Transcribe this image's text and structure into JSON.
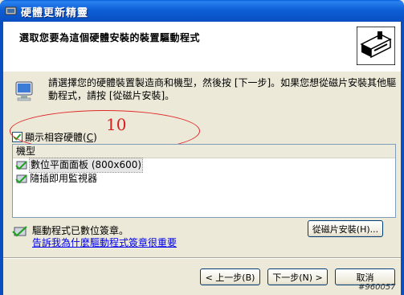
{
  "window": {
    "title": "硬體更新精靈"
  },
  "header": {
    "title": "選取您要為這個硬體安裝的裝置驅動程式"
  },
  "info": {
    "text": "請選擇您的硬體裝置製造商和機型，然後按 [下一步]。如果您想從磁片安裝其他驅動程式，請按 [從磁片安裝]。"
  },
  "compatible": {
    "label_prefix": "顯示相容硬體(",
    "label_key": "C",
    "label_suffix": ")",
    "checked": true
  },
  "annotation": {
    "number": "10"
  },
  "model_list": {
    "header": "機型",
    "items": [
      {
        "label": "數位平面面板 (800x600)",
        "selected": true
      },
      {
        "label": "隨插即用監視器",
        "selected": false
      }
    ]
  },
  "signature": {
    "status": "驅動程式已數位簽章。",
    "link": "告訴我為什麼驅動程式簽章很重要"
  },
  "buttons": {
    "have_disk": "從磁片安裝(H)...",
    "back": "< 上一步(B)",
    "next": "下一步(N) >",
    "cancel": "取消"
  },
  "watermark": "#960057",
  "colors": {
    "titlebar": "#0a5fd8",
    "dialog_bg": "#ece9d8",
    "annotation": "#e02828",
    "link": "#0000ee"
  }
}
